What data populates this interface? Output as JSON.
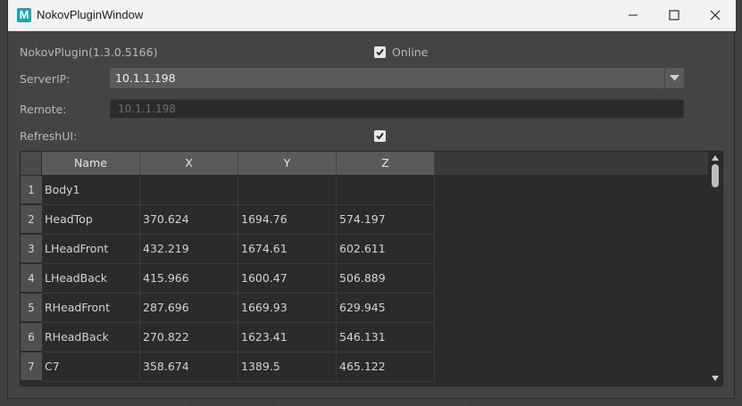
{
  "window": {
    "title": "NokovPluginWindow",
    "app_icon_letter": "M",
    "accent_color": "#1aa7b5"
  },
  "controls": {
    "version_label": "NokovPlugin(1.3.0.5166)",
    "online_label": "Online",
    "online_checked": true,
    "server_ip_label": "ServerIP:",
    "server_ip_value": "10.1.1.198",
    "remote_label": "Remote:",
    "remote_value": "10.1.1.198",
    "refresh_ui_label": "RefreshUI:",
    "refresh_ui_checked": true
  },
  "table": {
    "columns": [
      "Name",
      "X",
      "Y",
      "Z"
    ],
    "rows": [
      {
        "index": "1",
        "name": "Body1",
        "x": "",
        "y": "",
        "z": ""
      },
      {
        "index": "2",
        "name": "HeadTop",
        "x": "370.624",
        "y": "1694.76",
        "z": "574.197"
      },
      {
        "index": "3",
        "name": "LHeadFront",
        "x": "432.219",
        "y": "1674.61",
        "z": "602.611"
      },
      {
        "index": "4",
        "name": "LHeadBack",
        "x": "415.966",
        "y": "1600.47",
        "z": "506.889"
      },
      {
        "index": "5",
        "name": "RHeadFront",
        "x": "287.696",
        "y": "1669.93",
        "z": "629.945"
      },
      {
        "index": "6",
        "name": "RHeadBack",
        "x": "270.822",
        "y": "1623.41",
        "z": "546.131"
      },
      {
        "index": "7",
        "name": "C7",
        "x": "358.674",
        "y": "1389.5",
        "z": "465.122"
      }
    ]
  }
}
